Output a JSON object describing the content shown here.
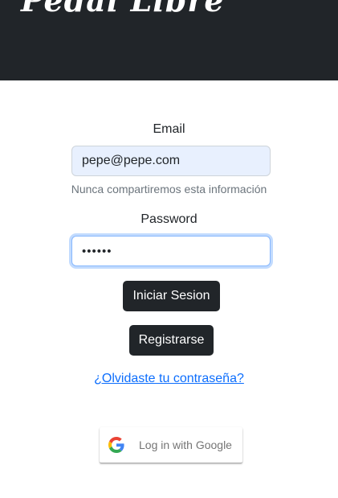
{
  "header": {
    "brand": "Pedal Libre"
  },
  "form": {
    "email_label": "Email",
    "email_value": "pepe@pepe.com",
    "email_help": "Nunca compartiremos esta información",
    "password_label": "Password",
    "password_value": "••••••",
    "login_button": "Iniciar Sesion",
    "register_button": "Registrarse",
    "forgot_link": "¿Olvidaste tu contraseña?"
  },
  "google": {
    "button_label": "Log in with Google",
    "icon": "google-icon"
  },
  "colors": {
    "header_bg": "#212529",
    "button_bg": "#212529",
    "link": "#0d6efd",
    "autofill_bg": "#e8f0fe",
    "focus_border": "#86b7fe"
  }
}
